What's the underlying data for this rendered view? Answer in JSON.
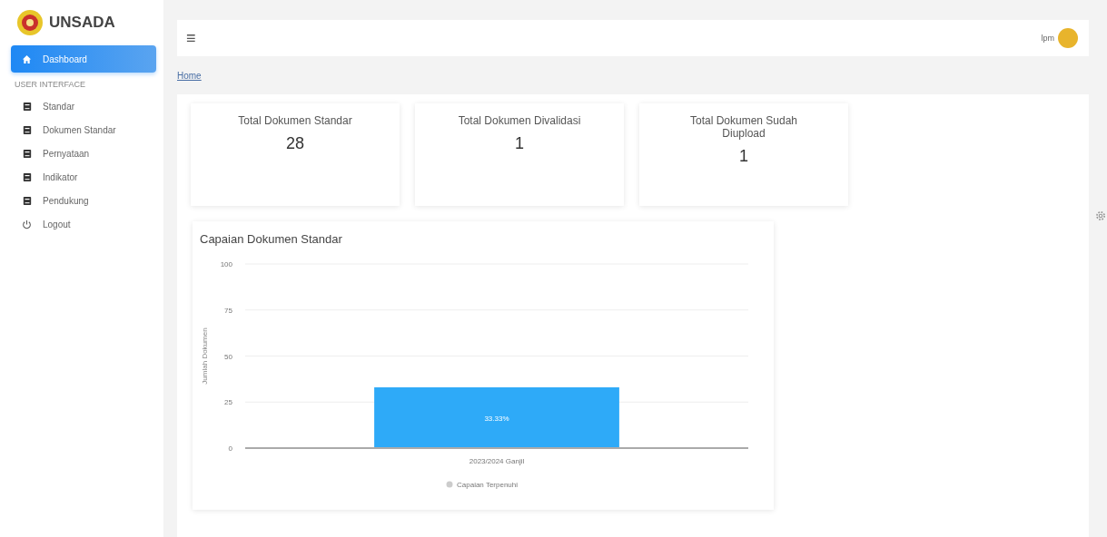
{
  "brand": {
    "name": "UNSADA"
  },
  "sidebar": {
    "items": [
      {
        "kind": "home",
        "label": "Dashboard",
        "selected": true
      },
      {
        "kind": "heading",
        "label": "USER INTERFACE"
      },
      {
        "kind": "book",
        "label": "Standar",
        "selected": false
      },
      {
        "kind": "book",
        "label": "Dokumen Standar",
        "selected": false
      },
      {
        "kind": "book",
        "label": "Pernyataan",
        "selected": false
      },
      {
        "kind": "book",
        "label": "Indikator",
        "selected": false
      },
      {
        "kind": "book",
        "label": "Pendukung",
        "selected": false
      },
      {
        "kind": "logout",
        "label": "Logout",
        "selected": false
      }
    ]
  },
  "topbar": {
    "menu_icon": "≡",
    "user": "lpm"
  },
  "breadcrumb": [
    "Home"
  ],
  "stats": [
    {
      "label": "Total Dokumen Standar",
      "value": "28"
    },
    {
      "label": "Total Dokumen Divalidasi",
      "value": "1"
    },
    {
      "label": "Total Dokumen Sudah Diupload",
      "value": "1"
    }
  ],
  "chart": {
    "title": "Capaian Dokumen Standar",
    "chart_data": {
      "type": "bar",
      "ylabel": "Jumlah Dokumen",
      "categories": [
        "2023/2024 Ganjil"
      ],
      "series": [
        {
          "name": "Capaian Terpenuhi",
          "color": "#2eaaf8",
          "values": [
            33
          ]
        }
      ],
      "grid": true,
      "ylim": [
        0,
        100
      ],
      "yticks": [
        0,
        25,
        50,
        75,
        100
      ],
      "value_labels": [
        "33.33%"
      ]
    }
  }
}
